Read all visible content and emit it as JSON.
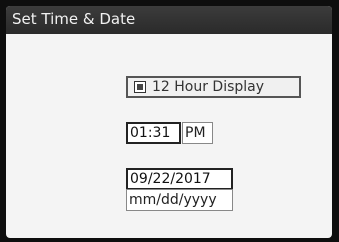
{
  "window": {
    "title": "Set Time & Date"
  },
  "display": {
    "checkbox_label": "12 Hour Display",
    "checkbox_checked": true
  },
  "time": {
    "value": "01:31",
    "ampm": "PM"
  },
  "date": {
    "value": "09/22/2017",
    "format": "mm/dd/yyyy"
  },
  "icons": {
    "checkbox": "checkbox-checked-icon"
  },
  "colors": {
    "titlebar": "#2f2f2f",
    "title_text": "#f2f2f2",
    "screen_background": "#f4f4f4"
  }
}
